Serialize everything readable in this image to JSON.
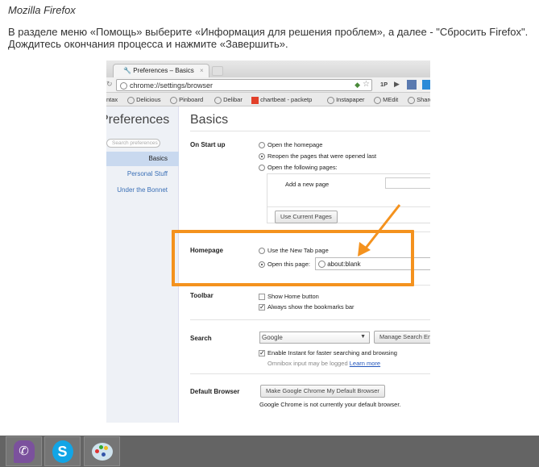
{
  "article": {
    "heading": "Mozilla Firefox",
    "instructions_line1": "В разделе меню «Помощь» выберите «Информация для решения проблем», а далее - \"Сбросить Firefox\".",
    "instructions_line2": "Дождитесь окончания процесса и нажмите «Завершить»."
  },
  "browser": {
    "tab_title": "Preferences – Basics",
    "tab_close": "×",
    "url": "chrome://settings/browser",
    "toolbar_badge": "1P",
    "bookmarks": [
      "ntax",
      "Delicious",
      "Pinboard",
      "Delibar",
      "chartbeat - packetp",
      "Instapaper",
      "MEdit",
      "Share"
    ]
  },
  "settings": {
    "sidebar_title": "Preferences",
    "search_placeholder": "Search preferences",
    "nav": [
      "Basics",
      "Personal Stuff",
      "Under the Bonnet"
    ],
    "page_title": "Basics",
    "startup": {
      "label": "On Start up",
      "options": [
        "Open the homepage",
        "Reopen the pages that were opened last",
        "Open the following pages:"
      ],
      "add_page": "Add a new page",
      "use_current": "Use Current Pages"
    },
    "homepage": {
      "label": "Homepage",
      "option_newtab": "Use the New Tab page",
      "option_open": "Open this page:",
      "value": "about:blank"
    },
    "toolbar": {
      "label": "Toolbar",
      "show_home": "Show Home button",
      "bookmarks_bar": "Always show the bookmarks bar"
    },
    "search": {
      "label": "Search",
      "engine": "Google",
      "manage": "Manage Search Engines",
      "instant": "Enable Instant for faster searching and browsing",
      "omnibox_note": "Omnibox input may be logged",
      "learn_more": "Learn more"
    },
    "default_browser": {
      "label": "Default Browser",
      "button": "Make Google Chrome My Default Browser",
      "status": "Google Chrome is not currently your default browser."
    }
  },
  "highlight_color": "#f4921e",
  "taskbar": {
    "apps": [
      "viber-icon",
      "skype-icon",
      "paint-icon"
    ]
  }
}
